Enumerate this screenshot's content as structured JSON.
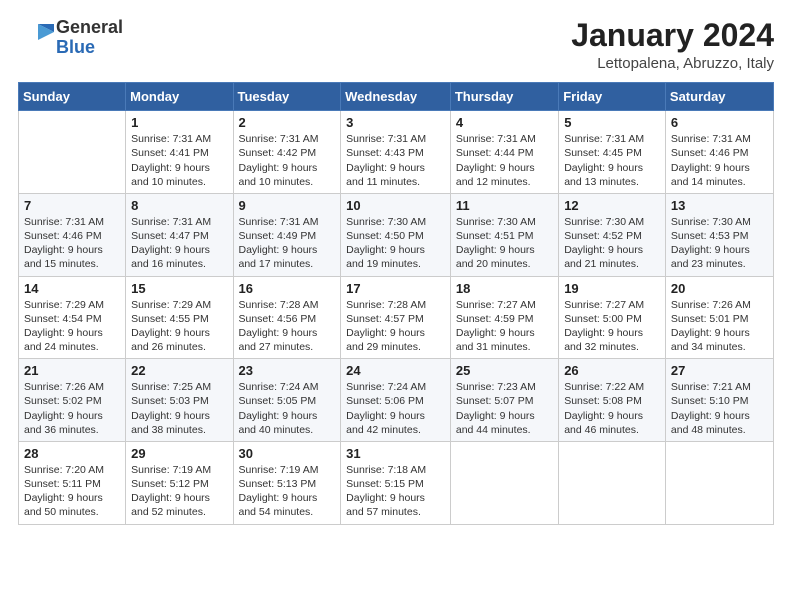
{
  "logo": {
    "general": "General",
    "blue": "Blue"
  },
  "title": "January 2024",
  "location": "Lettopalena, Abruzzo, Italy",
  "days_header": [
    "Sunday",
    "Monday",
    "Tuesday",
    "Wednesday",
    "Thursday",
    "Friday",
    "Saturday"
  ],
  "weeks": [
    [
      {
        "day": "",
        "info": ""
      },
      {
        "day": "1",
        "info": "Sunrise: 7:31 AM\nSunset: 4:41 PM\nDaylight: 9 hours\nand 10 minutes."
      },
      {
        "day": "2",
        "info": "Sunrise: 7:31 AM\nSunset: 4:42 PM\nDaylight: 9 hours\nand 10 minutes."
      },
      {
        "day": "3",
        "info": "Sunrise: 7:31 AM\nSunset: 4:43 PM\nDaylight: 9 hours\nand 11 minutes."
      },
      {
        "day": "4",
        "info": "Sunrise: 7:31 AM\nSunset: 4:44 PM\nDaylight: 9 hours\nand 12 minutes."
      },
      {
        "day": "5",
        "info": "Sunrise: 7:31 AM\nSunset: 4:45 PM\nDaylight: 9 hours\nand 13 minutes."
      },
      {
        "day": "6",
        "info": "Sunrise: 7:31 AM\nSunset: 4:46 PM\nDaylight: 9 hours\nand 14 minutes."
      }
    ],
    [
      {
        "day": "7",
        "info": "Sunrise: 7:31 AM\nSunset: 4:46 PM\nDaylight: 9 hours\nand 15 minutes."
      },
      {
        "day": "8",
        "info": "Sunrise: 7:31 AM\nSunset: 4:47 PM\nDaylight: 9 hours\nand 16 minutes."
      },
      {
        "day": "9",
        "info": "Sunrise: 7:31 AM\nSunset: 4:49 PM\nDaylight: 9 hours\nand 17 minutes."
      },
      {
        "day": "10",
        "info": "Sunrise: 7:30 AM\nSunset: 4:50 PM\nDaylight: 9 hours\nand 19 minutes."
      },
      {
        "day": "11",
        "info": "Sunrise: 7:30 AM\nSunset: 4:51 PM\nDaylight: 9 hours\nand 20 minutes."
      },
      {
        "day": "12",
        "info": "Sunrise: 7:30 AM\nSunset: 4:52 PM\nDaylight: 9 hours\nand 21 minutes."
      },
      {
        "day": "13",
        "info": "Sunrise: 7:30 AM\nSunset: 4:53 PM\nDaylight: 9 hours\nand 23 minutes."
      }
    ],
    [
      {
        "day": "14",
        "info": "Sunrise: 7:29 AM\nSunset: 4:54 PM\nDaylight: 9 hours\nand 24 minutes."
      },
      {
        "day": "15",
        "info": "Sunrise: 7:29 AM\nSunset: 4:55 PM\nDaylight: 9 hours\nand 26 minutes."
      },
      {
        "day": "16",
        "info": "Sunrise: 7:28 AM\nSunset: 4:56 PM\nDaylight: 9 hours\nand 27 minutes."
      },
      {
        "day": "17",
        "info": "Sunrise: 7:28 AM\nSunset: 4:57 PM\nDaylight: 9 hours\nand 29 minutes."
      },
      {
        "day": "18",
        "info": "Sunrise: 7:27 AM\nSunset: 4:59 PM\nDaylight: 9 hours\nand 31 minutes."
      },
      {
        "day": "19",
        "info": "Sunrise: 7:27 AM\nSunset: 5:00 PM\nDaylight: 9 hours\nand 32 minutes."
      },
      {
        "day": "20",
        "info": "Sunrise: 7:26 AM\nSunset: 5:01 PM\nDaylight: 9 hours\nand 34 minutes."
      }
    ],
    [
      {
        "day": "21",
        "info": "Sunrise: 7:26 AM\nSunset: 5:02 PM\nDaylight: 9 hours\nand 36 minutes."
      },
      {
        "day": "22",
        "info": "Sunrise: 7:25 AM\nSunset: 5:03 PM\nDaylight: 9 hours\nand 38 minutes."
      },
      {
        "day": "23",
        "info": "Sunrise: 7:24 AM\nSunset: 5:05 PM\nDaylight: 9 hours\nand 40 minutes."
      },
      {
        "day": "24",
        "info": "Sunrise: 7:24 AM\nSunset: 5:06 PM\nDaylight: 9 hours\nand 42 minutes."
      },
      {
        "day": "25",
        "info": "Sunrise: 7:23 AM\nSunset: 5:07 PM\nDaylight: 9 hours\nand 44 minutes."
      },
      {
        "day": "26",
        "info": "Sunrise: 7:22 AM\nSunset: 5:08 PM\nDaylight: 9 hours\nand 46 minutes."
      },
      {
        "day": "27",
        "info": "Sunrise: 7:21 AM\nSunset: 5:10 PM\nDaylight: 9 hours\nand 48 minutes."
      }
    ],
    [
      {
        "day": "28",
        "info": "Sunrise: 7:20 AM\nSunset: 5:11 PM\nDaylight: 9 hours\nand 50 minutes."
      },
      {
        "day": "29",
        "info": "Sunrise: 7:19 AM\nSunset: 5:12 PM\nDaylight: 9 hours\nand 52 minutes."
      },
      {
        "day": "30",
        "info": "Sunrise: 7:19 AM\nSunset: 5:13 PM\nDaylight: 9 hours\nand 54 minutes."
      },
      {
        "day": "31",
        "info": "Sunrise: 7:18 AM\nSunset: 5:15 PM\nDaylight: 9 hours\nand 57 minutes."
      },
      {
        "day": "",
        "info": ""
      },
      {
        "day": "",
        "info": ""
      },
      {
        "day": "",
        "info": ""
      }
    ]
  ]
}
